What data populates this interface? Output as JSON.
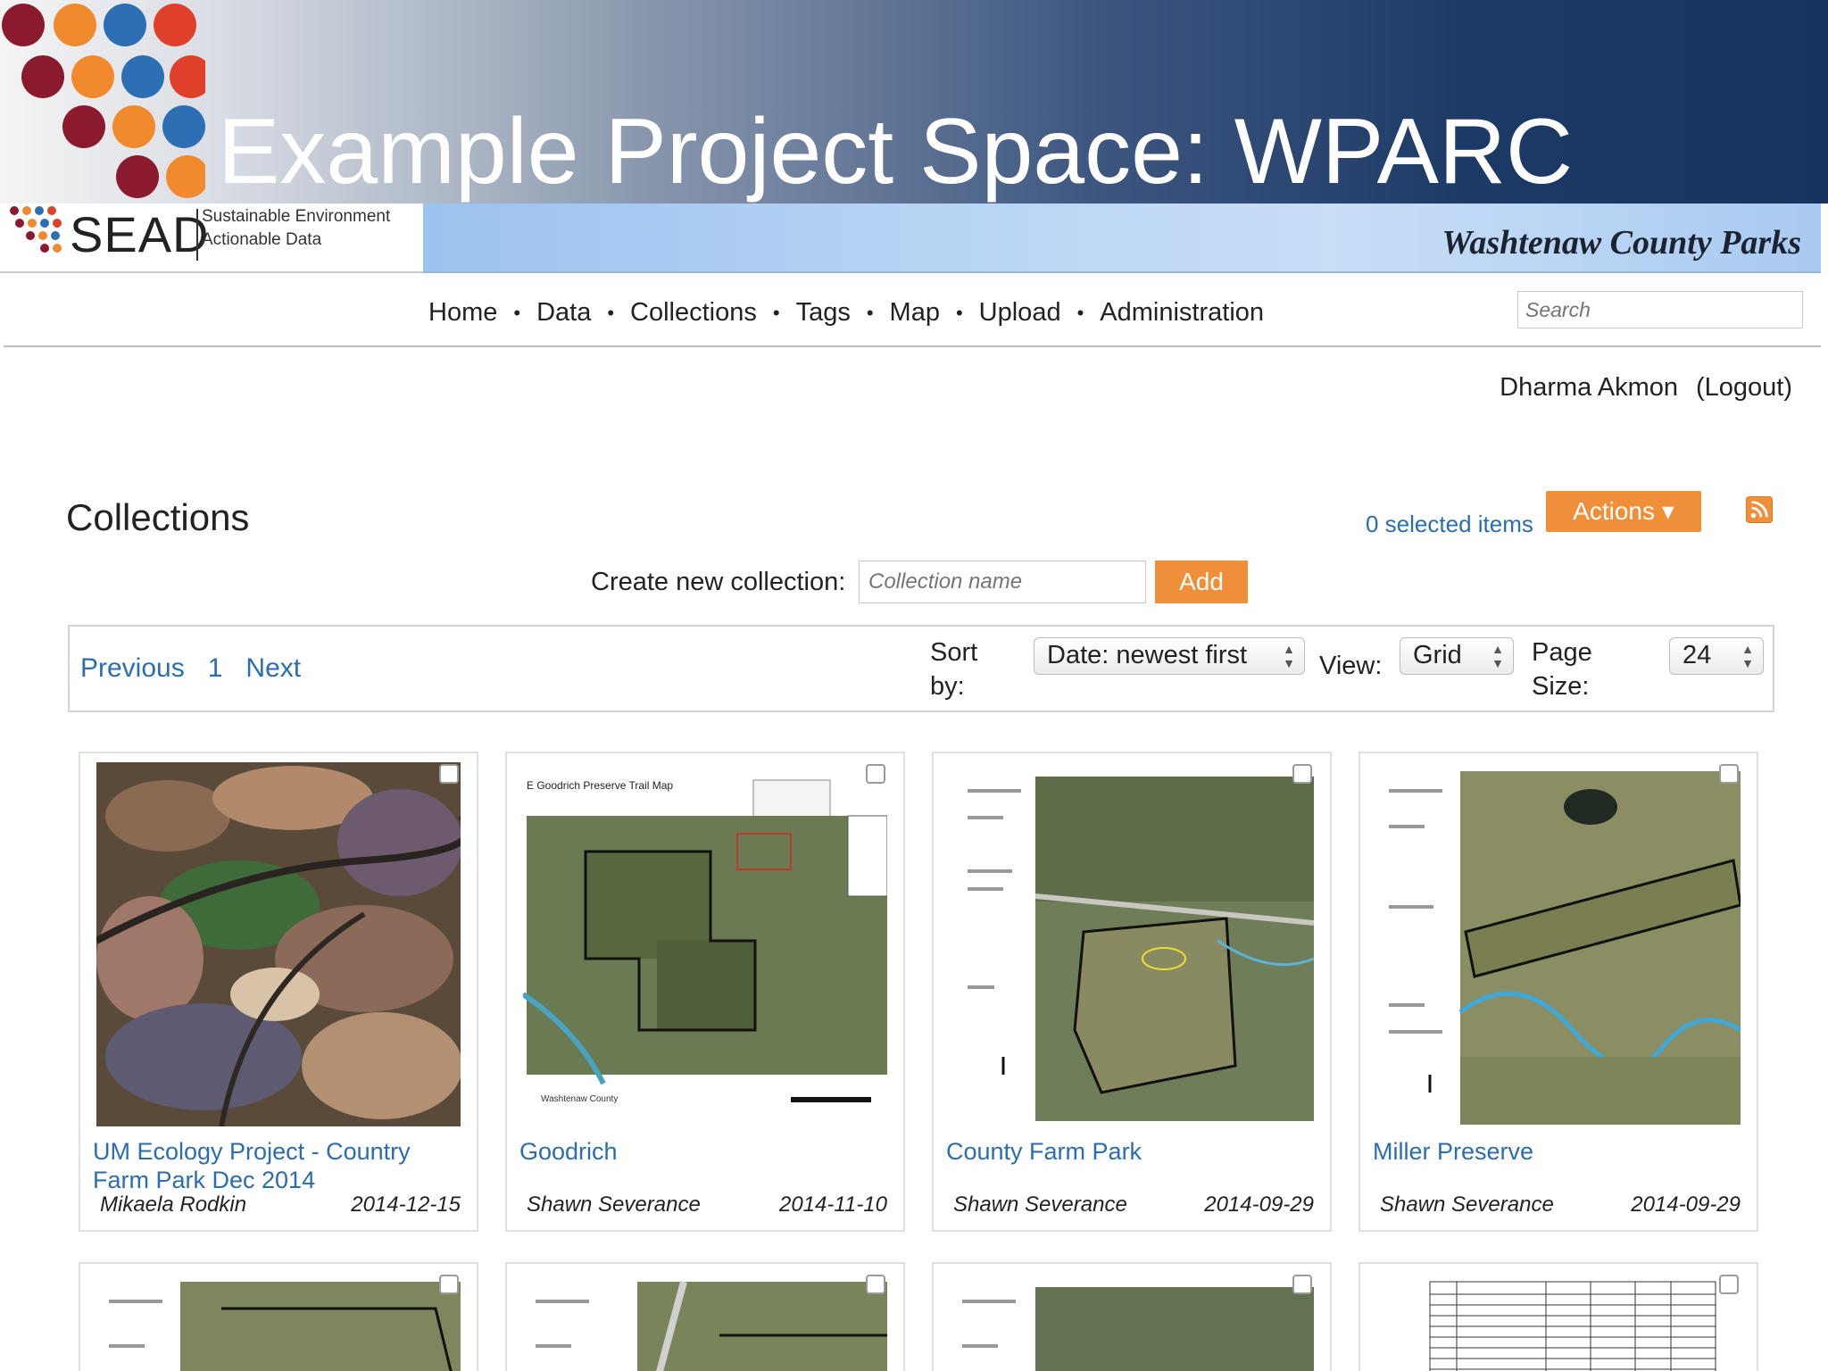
{
  "slide": {
    "title": "Example Project Space: WPARC"
  },
  "banner": {
    "sead_word": "SEAD",
    "sead_tagline_line1": "Sustainable Environment",
    "sead_tagline_line2": "Actionable Data",
    "org_name": "Washtenaw County Parks"
  },
  "nav": {
    "items": [
      "Home",
      "Data",
      "Collections",
      "Tags",
      "Map",
      "Upload",
      "Administration"
    ],
    "search_placeholder": "Search"
  },
  "user": {
    "name": "Dharma Akmon",
    "logout": "(Logout)"
  },
  "collections": {
    "title": "Collections",
    "selected_items": "0 selected items",
    "actions_label": "Actions ▾",
    "create_label": "Create new collection:",
    "create_placeholder": "Collection name",
    "add_label": "Add"
  },
  "toolbar": {
    "previous": "Previous",
    "page": "1",
    "next": "Next",
    "sort_label_1": "Sort",
    "sort_label_2": "by:",
    "sort_value": "Date: newest first",
    "view_label": "View:",
    "view_value": "Grid",
    "pagesize_label_1": "Page",
    "pagesize_label_2": "Size:",
    "pagesize_value": "24"
  },
  "cards": [
    {
      "title": "UM Ecology Project - Country Farm Park Dec 2014",
      "author": "Mikaela Rodkin",
      "date": "2014-12-15",
      "thumb": "leaves-photo"
    },
    {
      "title": "Goodrich",
      "author": "Shawn Severance",
      "date": "2014-11-10",
      "thumb": "trail-map",
      "thumb_title": "E Goodrich Preserve Trail Map"
    },
    {
      "title": "County Farm Park",
      "author": "Shawn Severance",
      "date": "2014-09-29",
      "thumb": "aerial-map"
    },
    {
      "title": "Miller Preserve",
      "author": "Shawn Severance",
      "date": "2014-09-29",
      "thumb": "aerial-map"
    }
  ],
  "colors": {
    "accent": "#f08f3a",
    "link": "#2a6db0",
    "header_dark": "#17335f"
  }
}
